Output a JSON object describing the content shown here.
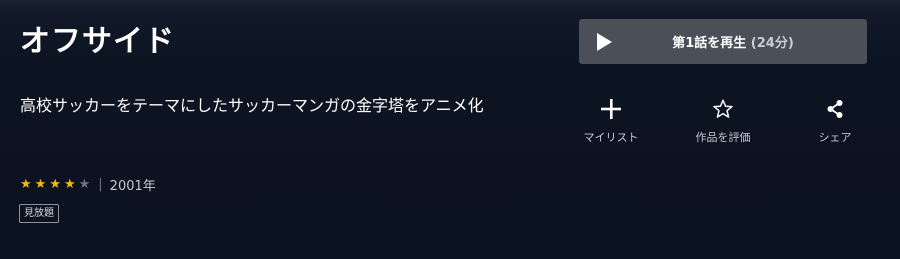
{
  "title": "オフサイド",
  "description": "高校サッカーをテーマにしたサッカーマンガの金字塔をアニメ化",
  "rating": {
    "score": 4,
    "max": 5
  },
  "year": "2001年",
  "separator": "|",
  "badge": "見放題",
  "play": {
    "label": "第1話を再生",
    "duration": "(24分)"
  },
  "actions": {
    "mylist": "マイリスト",
    "rate": "作品を評価",
    "share": "シェア"
  },
  "colors": {
    "background": "#0d1422",
    "star_on": "#f5b716",
    "star_off": "#6c7280",
    "play_button": "#4a4f58"
  },
  "icons": {
    "mylist": "plus-icon",
    "rate": "star-outline-icon",
    "share": "share-icon",
    "play": "play-icon"
  }
}
